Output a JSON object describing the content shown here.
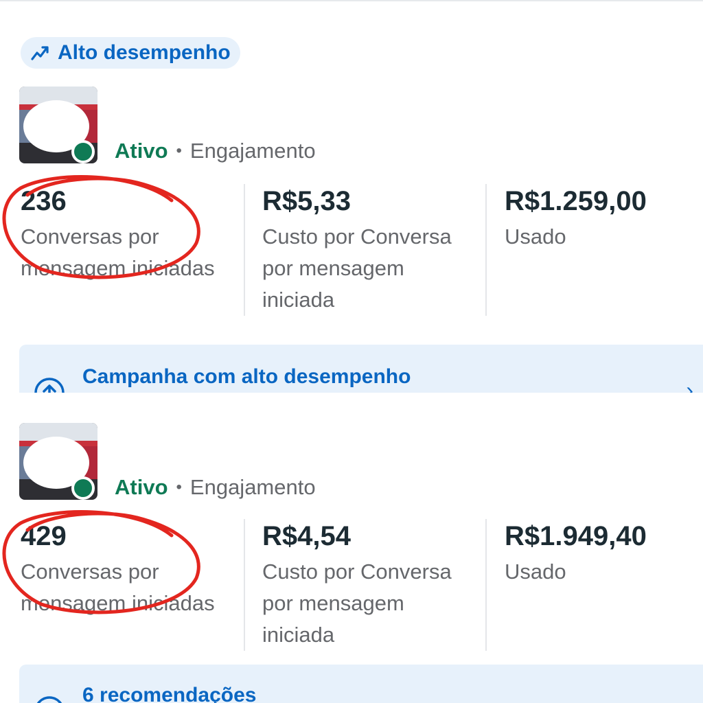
{
  "badge": {
    "label": "Alto desempenho",
    "icon": "trend-up-icon"
  },
  "campaigns": [
    {
      "status": "Ativo",
      "objective": "Engajamento",
      "metrics": [
        {
          "value": "236",
          "label_lines": [
            "Conversas por",
            "mensagem iniciadas"
          ]
        },
        {
          "value": "R$5,33",
          "label_lines": [
            "Custo por Conversa",
            "por mensagem",
            "iniciada"
          ]
        },
        {
          "value": "R$1.259,00",
          "label_lines": [
            "Usado"
          ]
        }
      ],
      "banner": {
        "label": "Campanha com alto desempenho",
        "icon": "arrow-up-circle-icon"
      }
    },
    {
      "status": "Ativo",
      "objective": "Engajamento",
      "metrics": [
        {
          "value": "429",
          "label_lines": [
            "Conversas por",
            "mensagem iniciadas"
          ]
        },
        {
          "value": "R$4,54",
          "label_lines": [
            "Custo por Conversa",
            "por mensagem",
            "iniciada"
          ]
        },
        {
          "value": "R$1.949,40",
          "label_lines": [
            "Usado"
          ]
        }
      ],
      "banner": {
        "label": "6 recomendações",
        "icon": "lightbulb-icon"
      }
    }
  ],
  "colors": {
    "accent": "#0a66c2",
    "active": "#0f7a55",
    "annotation": "#e3261f",
    "banner_bg": "#e7f1fb"
  }
}
